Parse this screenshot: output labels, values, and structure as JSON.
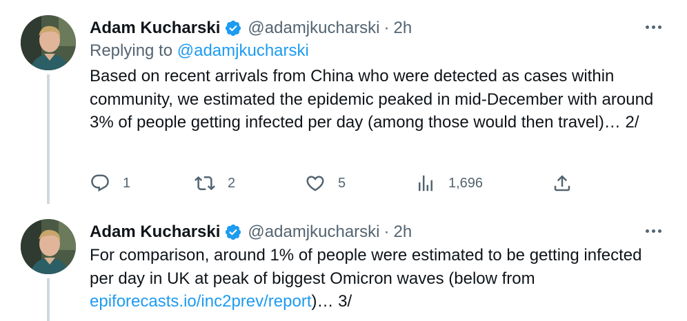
{
  "tweets": [
    {
      "author": {
        "display_name": "Adam Kucharski",
        "handle": "@adamjkucharski",
        "verified": true
      },
      "separator": "·",
      "time": "2h",
      "replying_prefix": "Replying to",
      "replying_to": "@adamjkucharski",
      "text": "Based on recent arrivals from China who were detected as cases within community, we estimated the epidemic peaked in mid-December with around 3% of people getting infected per day (among those would then travel)… 2/",
      "metrics": {
        "replies": "1",
        "retweets": "2",
        "likes": "5",
        "views": "1,696"
      }
    },
    {
      "author": {
        "display_name": "Adam Kucharski",
        "handle": "@adamjkucharski",
        "verified": true
      },
      "separator": "·",
      "time": "2h",
      "text_before_link": "For comparison, around 1% of people were estimated to be getting infected per day in UK at peak of biggest Omicron waves (below from ",
      "link_text": "epiforecasts.io/inc2prev/report",
      "text_after_link": ")… 3/"
    }
  ],
  "colors": {
    "accent": "#1d9bf0",
    "secondary_text": "#536471",
    "primary_text": "#0f1419",
    "thread_line": "#cfd9de"
  },
  "icons": {
    "verified": "verified-badge-icon",
    "more": "more-dots-icon",
    "reply": "reply-icon",
    "retweet": "retweet-icon",
    "like": "heart-icon",
    "views": "views-chart-icon",
    "share": "share-icon"
  }
}
